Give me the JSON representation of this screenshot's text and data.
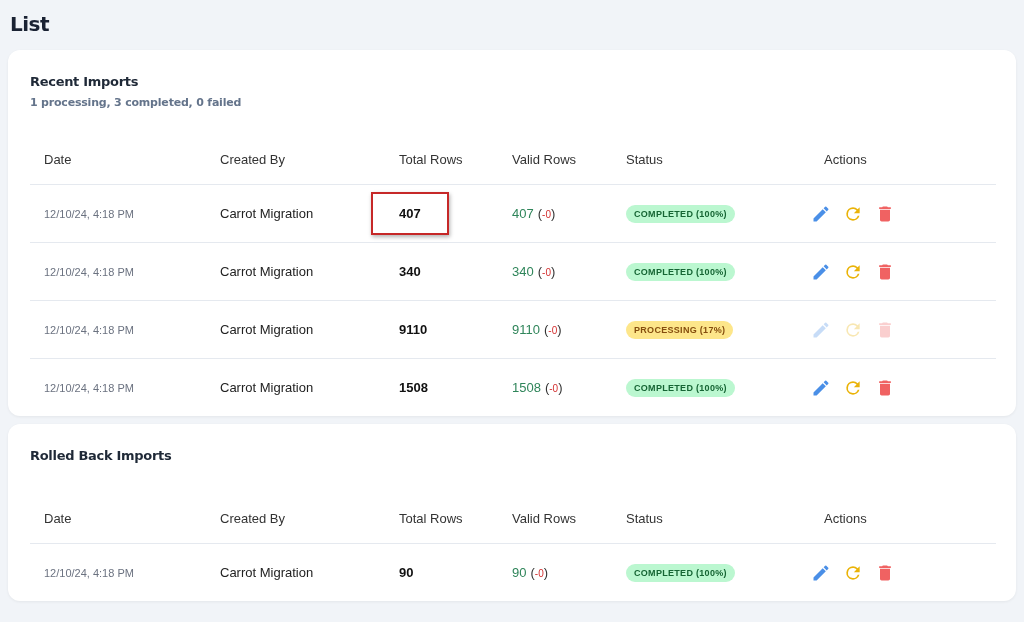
{
  "page_title": "List",
  "sections": [
    {
      "title": "Recent Imports",
      "summary": "1 processing, 3 completed, 0 failed",
      "columns": [
        "Date",
        "Created By",
        "Total Rows",
        "Valid Rows",
        "Status",
        "Actions"
      ],
      "rows": [
        {
          "date": "12/10/24, 4:18 PM",
          "created_by": "Carrot Migration",
          "total_rows": "407",
          "highlighted": true,
          "valid_rows": "407",
          "invalid_rows": "(-0)",
          "status": {
            "kind": "completed",
            "label": "COMPLETED (100%)"
          },
          "actions_disabled": false
        },
        {
          "date": "12/10/24, 4:18 PM",
          "created_by": "Carrot Migration",
          "total_rows": "340",
          "highlighted": false,
          "valid_rows": "340",
          "invalid_rows": "(-0)",
          "status": {
            "kind": "completed",
            "label": "COMPLETED (100%)"
          },
          "actions_disabled": false
        },
        {
          "date": "12/10/24, 4:18 PM",
          "created_by": "Carrot Migration",
          "total_rows": "9110",
          "highlighted": false,
          "valid_rows": "9110",
          "invalid_rows": "(-0)",
          "status": {
            "kind": "processing",
            "label": "PROCESSING (17%)"
          },
          "actions_disabled": true
        },
        {
          "date": "12/10/24, 4:18 PM",
          "created_by": "Carrot Migration",
          "total_rows": "1508",
          "highlighted": false,
          "valid_rows": "1508",
          "invalid_rows": "(-0)",
          "status": {
            "kind": "completed",
            "label": "COMPLETED (100%)"
          },
          "actions_disabled": false
        }
      ]
    },
    {
      "title": "Rolled Back Imports",
      "columns": [
        "Date",
        "Created By",
        "Total Rows",
        "Valid Rows",
        "Status",
        "Actions"
      ],
      "rows": [
        {
          "date": "12/10/24, 4:18 PM",
          "created_by": "Carrot Migration",
          "total_rows": "90",
          "highlighted": false,
          "valid_rows": "90",
          "invalid_rows": "(-0)",
          "status": {
            "kind": "completed",
            "label": "COMPLETED (100%)"
          },
          "actions_disabled": false
        }
      ]
    }
  ]
}
